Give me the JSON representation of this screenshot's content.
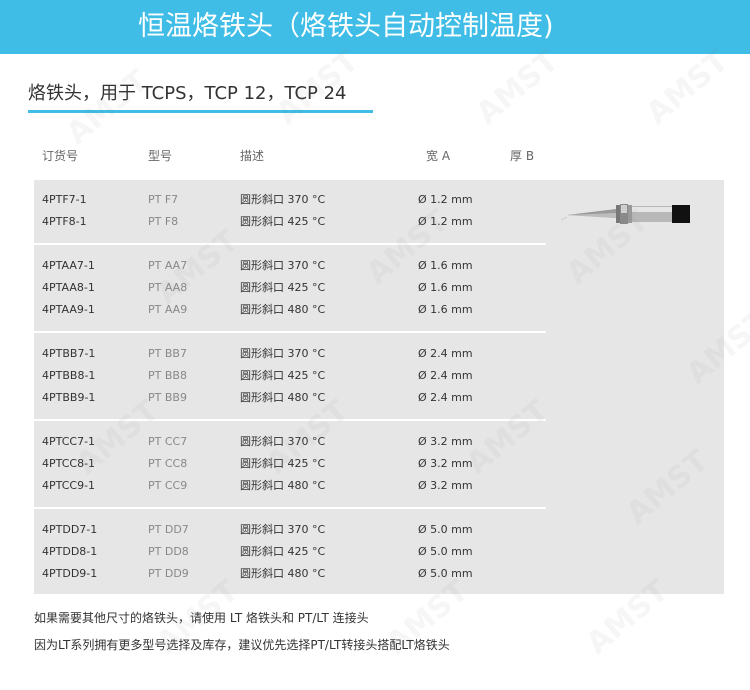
{
  "banner": {
    "title": "恒温烙铁头（烙铁头自动控制温度)"
  },
  "subtitle": "烙铁头，用于 TCPS，TCP 12，TCP 24",
  "headers": {
    "order": "订货号",
    "type": "型号",
    "desc": "描述",
    "width": "宽 A",
    "thickness": "厚 B"
  },
  "groups": [
    {
      "rows": [
        {
          "order": "4PTF7-1",
          "type": "PT F7",
          "desc": "圆形斜口 370 °C",
          "width": "Ø 1.2 mm"
        },
        {
          "order": "4PTF8-1",
          "type": "PT F8",
          "desc": "圆形斜口 425 °C",
          "width": "Ø 1.2 mm"
        }
      ]
    },
    {
      "rows": [
        {
          "order": "4PTAA7-1",
          "type": "PT AA7",
          "desc": "圆形斜口 370 °C",
          "width": "Ø 1.6 mm"
        },
        {
          "order": "4PTAA8-1",
          "type": "PT AA8",
          "desc": "圆形斜口 425 °C",
          "width": "Ø 1.6 mm"
        },
        {
          "order": "4PTAA9-1",
          "type": "PT AA9",
          "desc": "圆形斜口 480 °C",
          "width": "Ø 1.6 mm"
        }
      ]
    },
    {
      "rows": [
        {
          "order": "4PTBB7-1",
          "type": "PT BB7",
          "desc": "圆形斜口 370 °C",
          "width": "Ø 2.4 mm"
        },
        {
          "order": "4PTBB8-1",
          "type": "PT BB8",
          "desc": "圆形斜口 425 °C",
          "width": "Ø 2.4 mm"
        },
        {
          "order": "4PTBB9-1",
          "type": "PT BB9",
          "desc": "圆形斜口 480 °C",
          "width": "Ø 2.4 mm"
        }
      ]
    },
    {
      "rows": [
        {
          "order": "4PTCC7-1",
          "type": "PT CC7",
          "desc": "圆形斜口 370 °C",
          "width": "Ø 3.2 mm"
        },
        {
          "order": "4PTCC8-1",
          "type": "PT CC8",
          "desc": "圆形斜口 425 °C",
          "width": "Ø 3.2 mm"
        },
        {
          "order": "4PTCC9-1",
          "type": "PT CC9",
          "desc": "圆形斜口 480 °C",
          "width": "Ø 3.2 mm"
        }
      ]
    },
    {
      "rows": [
        {
          "order": "4PTDD7-1",
          "type": "PT DD7",
          "desc": "圆形斜口 370 °C",
          "width": "Ø 5.0 mm"
        },
        {
          "order": "4PTDD8-1",
          "type": "PT DD8",
          "desc": "圆形斜口 425 °C",
          "width": "Ø 5.0 mm"
        },
        {
          "order": "4PTDD9-1",
          "type": "PT DD9",
          "desc": "圆形斜口 480 °C",
          "width": "Ø 5.0 mm"
        }
      ]
    }
  ],
  "footer": [
    "如果需要其他尺寸的烙铁头，请使用 LT 烙铁头和 PT/LT 连接头",
    "因为LT系列拥有更多型号选择及库存，建议优先选择PT/LT转接头搭配LT烙铁头"
  ],
  "watermark": "AMST",
  "colors": {
    "banner": "#40bde6",
    "table_bg": "#e6e6e6",
    "accent_rule": "#40bde6"
  },
  "icons": {
    "tip_illustration": "soldering-tip-icon"
  }
}
